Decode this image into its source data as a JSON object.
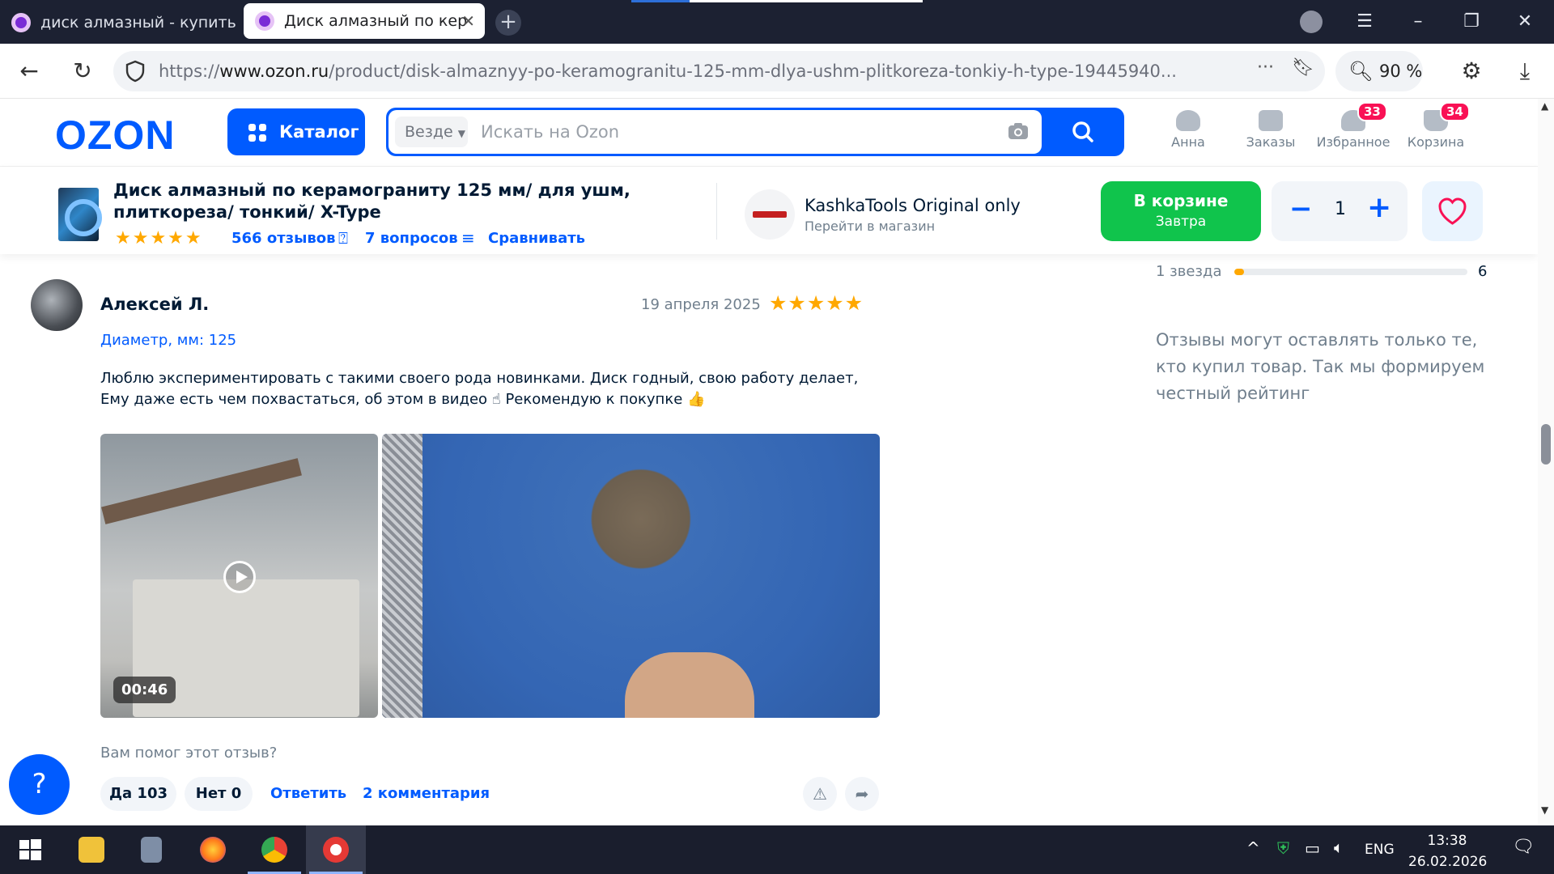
{
  "browser": {
    "tabs": [
      {
        "title": "диск алмазный - купить н",
        "active": false
      },
      {
        "title": "Диск алмазный по кер",
        "active": true
      }
    ],
    "url_host_prefix": "https://",
    "url_host": "www.ozon.ru",
    "url_path": "/product/disk-almaznyy-po-keramogranitu-125-mm-dlya-ushm-plitkoreza-tonkiy-h-type-19445940...",
    "zoom": "90 %"
  },
  "header": {
    "logo": "OZON",
    "catalog_label": "Каталог",
    "search_scope": "Везде",
    "search_placeholder": "Искать на Ozon",
    "user_label": "Анна",
    "orders_label": "Заказы",
    "favorites_label": "Избранное",
    "favorites_count": "33",
    "cart_label": "Корзина",
    "cart_count": "34"
  },
  "product": {
    "title": "Диск алмазный по керамограниту 125 мм/ для ушм, плиткореза/ тонкий/ X-Type",
    "rating_stars": "★★★★★",
    "reviews_link": "566 отзывов",
    "questions_link": "7 вопросов",
    "compare_link": "Сравнивать",
    "seller_name": "KashkaTools Original only",
    "seller_link": "Перейти в магазин",
    "cart_button_line1": "В корзине",
    "cart_button_line2": "Завтра",
    "quantity": "1"
  },
  "review": {
    "author": "Алексей Л.",
    "date": "19 апреля 2025",
    "stars": "★★★★★",
    "param": "Диаметр, мм: 125",
    "text": "Люблю экспериментировать с такими своего рода новинками. Диск годный, свою работу делает, Ему даже есть чем похвастаться, об этом в видео ☝ Рекомендую к покупке 👍",
    "video_duration": "00:46",
    "helpful_question": "Вам помог этот отзыв?",
    "yes_label": "Да 103",
    "no_label": "Нет 0",
    "reply_link": "Ответить",
    "comments_link": "2 комментария"
  },
  "rating_summary": {
    "row_label": "1 звезда",
    "row_count": "6",
    "row_fraction": 0.01
  },
  "side_note": "Отзывы могут оставлять только те, кто купил товар. Так мы формируем честный рейтинг",
  "taskbar": {
    "language": "ENG",
    "time": "13:38",
    "date": "26.02.2026"
  },
  "colors": {
    "ozon_blue": "#005bff",
    "cart_green": "#10c44c",
    "star_orange": "#ffa800",
    "badge_pink": "#f91155"
  }
}
